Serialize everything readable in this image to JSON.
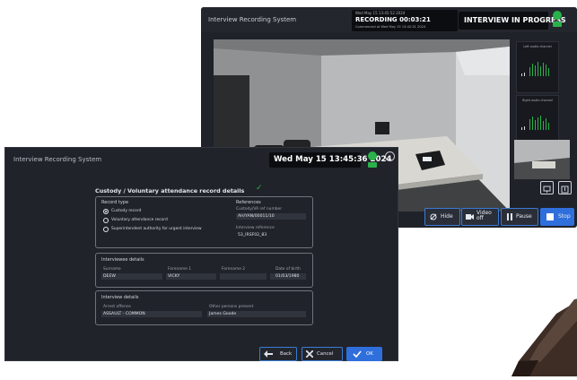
{
  "recording_window": {
    "title": "Interview Recording System",
    "status": {
      "line1": "Wed May 15 13:45:52 2024",
      "recording_label": "RECORDING 00:03:21",
      "line3": "Commenced at Wed May 15 13:42:31 2024"
    },
    "progress_label": "INTERVIEW IN PROGRESS",
    "audio_panels": [
      {
        "title": "Left audio channel"
      },
      {
        "title": "Right audio channel"
      }
    ],
    "controls": {
      "hide": "Hide",
      "video_off": "Video off",
      "pause": "Pause",
      "stop": "Stop"
    }
  },
  "form_window": {
    "title": "Interview Recording System",
    "clock": "Wed May 15 13:45:36 2024",
    "heading": "Custody / Voluntary attendance record details",
    "record_type": {
      "title": "Record type",
      "options": [
        {
          "label": "Custody record",
          "selected": true
        },
        {
          "label": "Voluntary attendance record",
          "selected": false
        },
        {
          "label": "Superintendent authority for urgent interview",
          "selected": false
        }
      ]
    },
    "references": {
      "title": "References",
      "custody_label": "Custody/VA ref number",
      "custody_value": "AH/YAN/00011/10",
      "interview_label": "Interview reference",
      "interview_value": "53_IRSF02_83"
    },
    "interviewee": {
      "title": "Interviewee details",
      "surname_label": "Surname",
      "surname_value": "DEEW",
      "forename1_label": "Forename 1",
      "forename1_value": "VICKY",
      "forename2_label": "Forename 2",
      "forename2_value": "",
      "dob_label": "Date of birth",
      "dob_value": "01/03/1980"
    },
    "interview": {
      "title": "Interview details",
      "offence_label": "Arrest offence",
      "offence_value": "ASSAULT - COMMON",
      "others_label": "Other persons present",
      "others_value": "James Goode"
    },
    "buttons": {
      "back": "Back",
      "cancel": "Cancel",
      "ok": "OK"
    }
  },
  "colors": {
    "accent": "#2f6fdc",
    "status_green": "#2ab24a",
    "window_bg": "#202329"
  }
}
